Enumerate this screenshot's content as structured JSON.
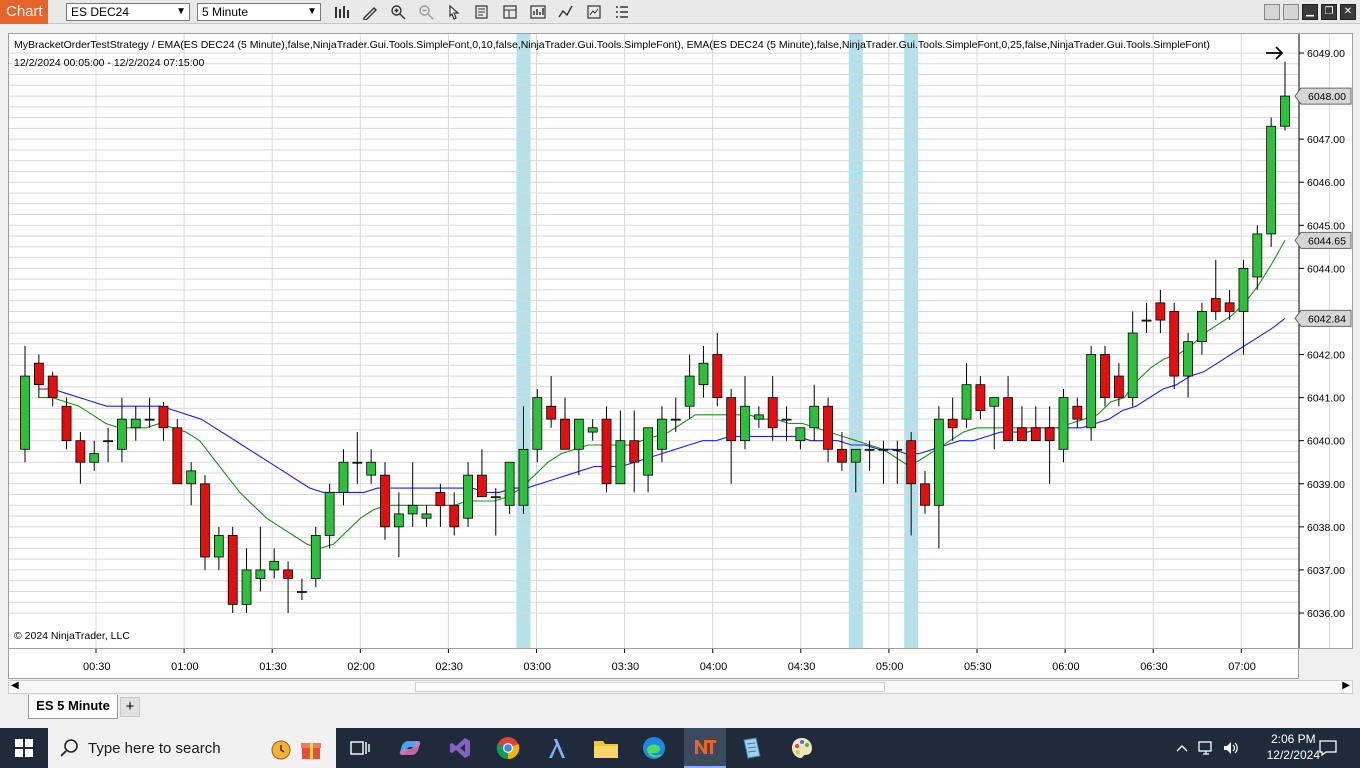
{
  "toolbar": {
    "chart_label": "Chart",
    "instrument": "ES DEC24",
    "interval": "5 Minute",
    "icons": [
      "bars-type-icon",
      "drawing-tool-icon",
      "zoom-in-icon",
      "zoom-out-icon",
      "pointer-icon",
      "data-box-icon",
      "templates-icon",
      "chart-trader-icon",
      "indicators-icon",
      "strategies-icon",
      "properties-menu-icon"
    ]
  },
  "window_controls": [
    "tile-icon",
    "tile-icon",
    "minimize-icon",
    "restore-icon",
    "close-icon"
  ],
  "chart": {
    "title": "MyBracketOrderTestStrategy / EMA(ES DEC24 (5 Minute),false,NinjaTrader.Gui.Tools.SimpleFont,0,10,false,NinjaTrader.Gui.Tools.SimpleFont), EMA(ES DEC24 (5 Minute),false,NinjaTrader.Gui.Tools.SimpleFont,0,25,false,NinjaTrader.Gui.Tools.SimpleFont)",
    "date_range": "12/2/2024 00:05:00 - 12/2/2024 07:15:00",
    "copyright": "© 2024 NinjaTrader, LLC",
    "price_labels": [
      "6049.00",
      "6047.00",
      "6046.00",
      "6045.00",
      "6044.00",
      "6042.00",
      "6041.00",
      "6040.00",
      "6039.00",
      "6038.00",
      "6037.00",
      "6036.00"
    ],
    "price_badges": {
      "last": "6048.00",
      "ema_fast": "6044.65",
      "ema_slow": "6042.84"
    },
    "time_labels": [
      "00:30",
      "01:00",
      "01:30",
      "02:00",
      "02:30",
      "03:00",
      "03:30",
      "04:00",
      "04:30",
      "05:00",
      "05:30",
      "06:00",
      "06:30",
      "07:00"
    ],
    "colors": {
      "up": "#2fbf3f",
      "down": "#e01010",
      "ema_fast": "#228b22",
      "ema_slow": "#2222dd",
      "highlight": "#a8dde6"
    }
  },
  "chart_data": {
    "type": "candlestick",
    "instrument": "ES DEC24",
    "interval": "5 Minute",
    "ylim": [
      6035.7,
      6049.3
    ],
    "y_ticks": [
      6036,
      6037,
      6038,
      6039,
      6040,
      6041,
      6042,
      6044,
      6045,
      6046,
      6047,
      6049
    ],
    "highlight_bars": [
      36,
      60,
      64
    ],
    "candles": [
      {
        "o": 6039.8,
        "h": 6042.2,
        "l": 6039.5,
        "c": 6041.5
      },
      {
        "o": 6041.8,
        "h": 6042.0,
        "l": 6041.0,
        "c": 6041.3
      },
      {
        "o": 6041.5,
        "h": 6041.6,
        "l": 6040.8,
        "c": 6041.0
      },
      {
        "o": 6040.8,
        "h": 6041.0,
        "l": 6039.8,
        "c": 6040.0
      },
      {
        "o": 6040.0,
        "h": 6040.2,
        "l": 6039.0,
        "c": 6039.5
      },
      {
        "o": 6039.5,
        "h": 6040.0,
        "l": 6039.3,
        "c": 6039.7
      },
      {
        "o": 6040.0,
        "h": 6040.3,
        "l": 6039.5,
        "c": 6040.0
      },
      {
        "o": 6039.8,
        "h": 6041.0,
        "l": 6039.5,
        "c": 6040.5
      },
      {
        "o": 6040.3,
        "h": 6040.8,
        "l": 6040.0,
        "c": 6040.5
      },
      {
        "o": 6040.5,
        "h": 6041.0,
        "l": 6040.3,
        "c": 6040.5
      },
      {
        "o": 6040.8,
        "h": 6040.9,
        "l": 6040.0,
        "c": 6040.3
      },
      {
        "o": 6040.3,
        "h": 6040.5,
        "l": 6039.0,
        "c": 6039.0
      },
      {
        "o": 6039.0,
        "h": 6039.5,
        "l": 6038.5,
        "c": 6039.3
      },
      {
        "o": 6039.0,
        "h": 6039.2,
        "l": 6037.0,
        "c": 6037.3
      },
      {
        "o": 6037.3,
        "h": 6038.0,
        "l": 6037.0,
        "c": 6037.8
      },
      {
        "o": 6037.8,
        "h": 6038.0,
        "l": 6036.0,
        "c": 6036.2
      },
      {
        "o": 6036.2,
        "h": 6037.5,
        "l": 6036.0,
        "c": 6037.0
      },
      {
        "o": 6036.8,
        "h": 6038.0,
        "l": 6036.5,
        "c": 6037.0
      },
      {
        "o": 6037.0,
        "h": 6037.5,
        "l": 6036.8,
        "c": 6037.2
      },
      {
        "o": 6037.0,
        "h": 6037.2,
        "l": 6036.0,
        "c": 6036.8
      },
      {
        "o": 6036.5,
        "h": 6036.8,
        "l": 6036.3,
        "c": 6036.5
      },
      {
        "o": 6036.8,
        "h": 6038.0,
        "l": 6036.6,
        "c": 6037.8
      },
      {
        "o": 6037.8,
        "h": 6039.0,
        "l": 6037.5,
        "c": 6038.8
      },
      {
        "o": 6038.8,
        "h": 6039.8,
        "l": 6038.5,
        "c": 6039.5
      },
      {
        "o": 6039.5,
        "h": 6040.2,
        "l": 6039.0,
        "c": 6039.5
      },
      {
        "o": 6039.2,
        "h": 6039.8,
        "l": 6039.0,
        "c": 6039.5
      },
      {
        "o": 6039.2,
        "h": 6039.5,
        "l": 6037.7,
        "c": 6038.0
      },
      {
        "o": 6038.0,
        "h": 6038.8,
        "l": 6037.3,
        "c": 6038.3
      },
      {
        "o": 6038.3,
        "h": 6039.5,
        "l": 6038.0,
        "c": 6038.5
      },
      {
        "o": 6038.2,
        "h": 6038.5,
        "l": 6038.0,
        "c": 6038.3
      },
      {
        "o": 6038.8,
        "h": 6039.0,
        "l": 6038.0,
        "c": 6038.5
      },
      {
        "o": 6038.5,
        "h": 6038.8,
        "l": 6037.8,
        "c": 6038.0
      },
      {
        "o": 6038.2,
        "h": 6039.5,
        "l": 6038.0,
        "c": 6039.2
      },
      {
        "o": 6039.2,
        "h": 6039.8,
        "l": 6038.7,
        "c": 6038.7
      },
      {
        "o": 6038.7,
        "h": 6038.9,
        "l": 6037.8,
        "c": 6038.7
      },
      {
        "o": 6038.5,
        "h": 6039.5,
        "l": 6038.3,
        "c": 6039.5
      },
      {
        "o": 6038.5,
        "h": 6040.8,
        "l": 6038.3,
        "c": 6039.8
      },
      {
        "o": 6039.8,
        "h": 6041.2,
        "l": 6039.5,
        "c": 6041.0
      },
      {
        "o": 6040.8,
        "h": 6041.5,
        "l": 6040.3,
        "c": 6040.5
      },
      {
        "o": 6040.5,
        "h": 6041.0,
        "l": 6039.8,
        "c": 6039.8
      },
      {
        "o": 6039.8,
        "h": 6040.5,
        "l": 6039.2,
        "c": 6040.5
      },
      {
        "o": 6040.2,
        "h": 6040.5,
        "l": 6040.0,
        "c": 6040.3
      },
      {
        "o": 6040.5,
        "h": 6040.8,
        "l": 6038.8,
        "c": 6039.0
      },
      {
        "o": 6039.0,
        "h": 6040.7,
        "l": 6039.0,
        "c": 6040.0
      },
      {
        "o": 6040.0,
        "h": 6040.7,
        "l": 6038.8,
        "c": 6039.5
      },
      {
        "o": 6039.2,
        "h": 6040.3,
        "l": 6038.8,
        "c": 6040.3
      },
      {
        "o": 6039.8,
        "h": 6040.8,
        "l": 6039.5,
        "c": 6040.5
      },
      {
        "o": 6040.5,
        "h": 6041.0,
        "l": 6040.2,
        "c": 6040.5
      },
      {
        "o": 6040.8,
        "h": 6042.0,
        "l": 6040.5,
        "c": 6041.5
      },
      {
        "o": 6041.3,
        "h": 6042.2,
        "l": 6041.0,
        "c": 6041.8
      },
      {
        "o": 6042.0,
        "h": 6042.5,
        "l": 6040.8,
        "c": 6041.0
      },
      {
        "o": 6041.0,
        "h": 6041.2,
        "l": 6039.0,
        "c": 6040.0
      },
      {
        "o": 6040.0,
        "h": 6041.5,
        "l": 6039.8,
        "c": 6040.8
      },
      {
        "o": 6040.5,
        "h": 6040.8,
        "l": 6040.3,
        "c": 6040.6
      },
      {
        "o": 6041.0,
        "h": 6041.5,
        "l": 6040.0,
        "c": 6040.3
      },
      {
        "o": 6040.5,
        "h": 6040.8,
        "l": 6040.0,
        "c": 6040.5
      },
      {
        "o": 6040.0,
        "h": 6040.3,
        "l": 6039.8,
        "c": 6040.3
      },
      {
        "o": 6040.3,
        "h": 6041.3,
        "l": 6040.0,
        "c": 6040.8
      },
      {
        "o": 6040.8,
        "h": 6041.0,
        "l": 6039.5,
        "c": 6039.8
      },
      {
        "o": 6039.8,
        "h": 6040.2,
        "l": 6039.3,
        "c": 6039.5
      },
      {
        "o": 6039.5,
        "h": 6039.8,
        "l": 6038.8,
        "c": 6039.8
      },
      {
        "o": 6039.8,
        "h": 6040.0,
        "l": 6039.3,
        "c": 6039.8
      },
      {
        "o": 6039.8,
        "h": 6040.0,
        "l": 6039.0,
        "c": 6039.8
      },
      {
        "o": 6039.8,
        "h": 6040.0,
        "l": 6039.0,
        "c": 6039.8
      },
      {
        "o": 6040.0,
        "h": 6040.2,
        "l": 6037.8,
        "c": 6039.0
      },
      {
        "o": 6039.0,
        "h": 6039.3,
        "l": 6038.3,
        "c": 6038.5
      },
      {
        "o": 6038.5,
        "h": 6040.8,
        "l": 6037.5,
        "c": 6040.5
      }
    ],
    "tail_candles": [
      {
        "o": 6040.5,
        "h": 6041.0,
        "l": 6040.0,
        "c": 6040.3
      },
      {
        "o": 6040.5,
        "h": 6041.8,
        "l": 6040.3,
        "c": 6041.3
      },
      {
        "o": 6041.3,
        "h": 6041.5,
        "l": 6040.5,
        "c": 6040.7
      },
      {
        "o": 6040.8,
        "h": 6041.0,
        "l": 6039.8,
        "c": 6041.0
      },
      {
        "o": 6041.0,
        "h": 6041.5,
        "l": 6040.2,
        "c": 6040.0
      },
      {
        "o": 6040.3,
        "h": 6040.8,
        "l": 6040.0,
        "c": 6040.0
      },
      {
        "o": 6040.3,
        "h": 6040.8,
        "l": 6040.0,
        "c": 6040.0
      },
      {
        "o": 6040.3,
        "h": 6040.8,
        "l": 6039.0,
        "c": 6040.0
      },
      {
        "o": 6039.8,
        "h": 6041.2,
        "l": 6039.5,
        "c": 6041.0
      },
      {
        "o": 6040.8,
        "h": 6041.0,
        "l": 6040.3,
        "c": 6040.5
      },
      {
        "o": 6040.3,
        "h": 6042.2,
        "l": 6040.0,
        "c": 6042.0
      },
      {
        "o": 6042.0,
        "h": 6042.2,
        "l": 6040.8,
        "c": 6041.0
      },
      {
        "o": 6041.5,
        "h": 6041.8,
        "l": 6040.8,
        "c": 6041.0
      },
      {
        "o": 6041.0,
        "h": 6043.0,
        "l": 6040.8,
        "c": 6042.5
      },
      {
        "o": 6042.8,
        "h": 6043.2,
        "l": 6042.5,
        "c": 6042.8
      },
      {
        "o": 6043.2,
        "h": 6043.5,
        "l": 6042.5,
        "c": 6042.8
      },
      {
        "o": 6043.0,
        "h": 6043.2,
        "l": 6041.2,
        "c": 6041.5
      },
      {
        "o": 6041.5,
        "h": 6042.5,
        "l": 6041.0,
        "c": 6042.3
      },
      {
        "o": 6042.3,
        "h": 6043.2,
        "l": 6042.0,
        "c": 6043.0
      },
      {
        "o": 6043.3,
        "h": 6044.2,
        "l": 6042.8,
        "c": 6043.0
      },
      {
        "o": 6043.2,
        "h": 6043.5,
        "l": 6042.8,
        "c": 6043.0
      },
      {
        "o": 6043.0,
        "h": 6044.2,
        "l": 6042.0,
        "c": 6044.0
      },
      {
        "o": 6043.8,
        "h": 6045.0,
        "l": 6043.5,
        "c": 6044.8
      },
      {
        "o": 6044.8,
        "h": 6047.5,
        "l": 6044.5,
        "c": 6047.3
      },
      {
        "o": 6047.3,
        "h": 6048.8,
        "l": 6047.2,
        "c": 6048.0
      }
    ],
    "ema_fast": [
      6041.0,
      6041.0,
      6040.9,
      6040.8,
      6040.6,
      6040.4,
      6040.3,
      6040.3,
      6040.3,
      6040.4,
      6040.3,
      6040.2,
      6040.0,
      6039.6,
      6039.2,
      6038.8,
      6038.5,
      6038.2,
      6038.0,
      6037.8,
      6037.6,
      6037.5,
      6037.6,
      6037.9,
      6038.2,
      6038.4,
      6038.5,
      6038.5,
      6038.5,
      6038.5,
      6038.5,
      6038.5,
      6038.6,
      6038.6,
      6038.6,
      6038.7,
      6038.9,
      6039.2,
      6039.5,
      6039.7,
      6039.8,
      6039.9,
      6039.9,
      6039.9,
      6039.9,
      6040.0,
      6040.1,
      6040.2,
      6040.4,
      6040.6,
      6040.6,
      6040.6,
      6040.6,
      6040.6,
      6040.5,
      6040.5,
      6040.4,
      6040.4,
      6040.3,
      6040.2,
      6040.1,
      6040.0,
      6039.9,
      6039.8,
      6039.6,
      6039.4,
      6039.6,
      6039.8,
      6040.0,
      6040.2,
      6040.3,
      6040.3,
      6040.3,
      6040.3,
      6040.3,
      6040.3,
      6040.3,
      6040.4,
      6040.5,
      6040.6,
      6040.9,
      6041.0,
      6041.4,
      6041.7,
      6041.9,
      6042.0,
      6042.2,
      6042.5,
      6042.7,
      6042.9,
      6043.2,
      6043.6,
      6044.1,
      6044.65
    ],
    "ema_slow": [
      6041.2,
      6041.2,
      6041.1,
      6041.0,
      6040.9,
      6040.8,
      6040.8,
      6040.8,
      6040.8,
      6040.8,
      6040.7,
      6040.6,
      6040.5,
      6040.3,
      6040.1,
      6039.9,
      6039.7,
      6039.5,
      6039.3,
      6039.1,
      6038.9,
      6038.8,
      6038.8,
      6038.8,
      6038.8,
      6038.9,
      6038.9,
      6038.9,
      6038.9,
      6038.9,
      6038.9,
      6038.9,
      6038.9,
      6038.8,
      6038.8,
      6038.9,
      6038.9,
      6039.0,
      6039.1,
      6039.2,
      6039.3,
      6039.4,
      6039.4,
      6039.4,
      6039.5,
      6039.6,
      6039.7,
      6039.8,
      6039.9,
      6040.0,
      6040.0,
      6040.1,
      6040.1,
      6040.1,
      6040.1,
      6040.1,
      6040.1,
      6040.0,
      6040.0,
      6040.0,
      6039.9,
      6039.9,
      6039.8,
      6039.8,
      6039.7,
      6039.7,
      6039.8,
      6039.9,
      6040.0,
      6040.0,
      6040.1,
      6040.2,
      6040.2,
      6040.2,
      6040.3,
      6040.3,
      6040.3,
      6040.3,
      6040.4,
      6040.5,
      6040.7,
      6040.8,
      6041.0,
      6041.2,
      6041.3,
      6041.5,
      6041.6,
      6041.8,
      6042.0,
      6042.2,
      6042.4,
      6042.6,
      6042.84
    ]
  },
  "tabs": {
    "active_label": "ES 5 Minute",
    "add_label": "+"
  },
  "taskbar": {
    "search_placeholder": "Type here to search",
    "time": "2:06 PM",
    "date": "12/2/2024"
  }
}
